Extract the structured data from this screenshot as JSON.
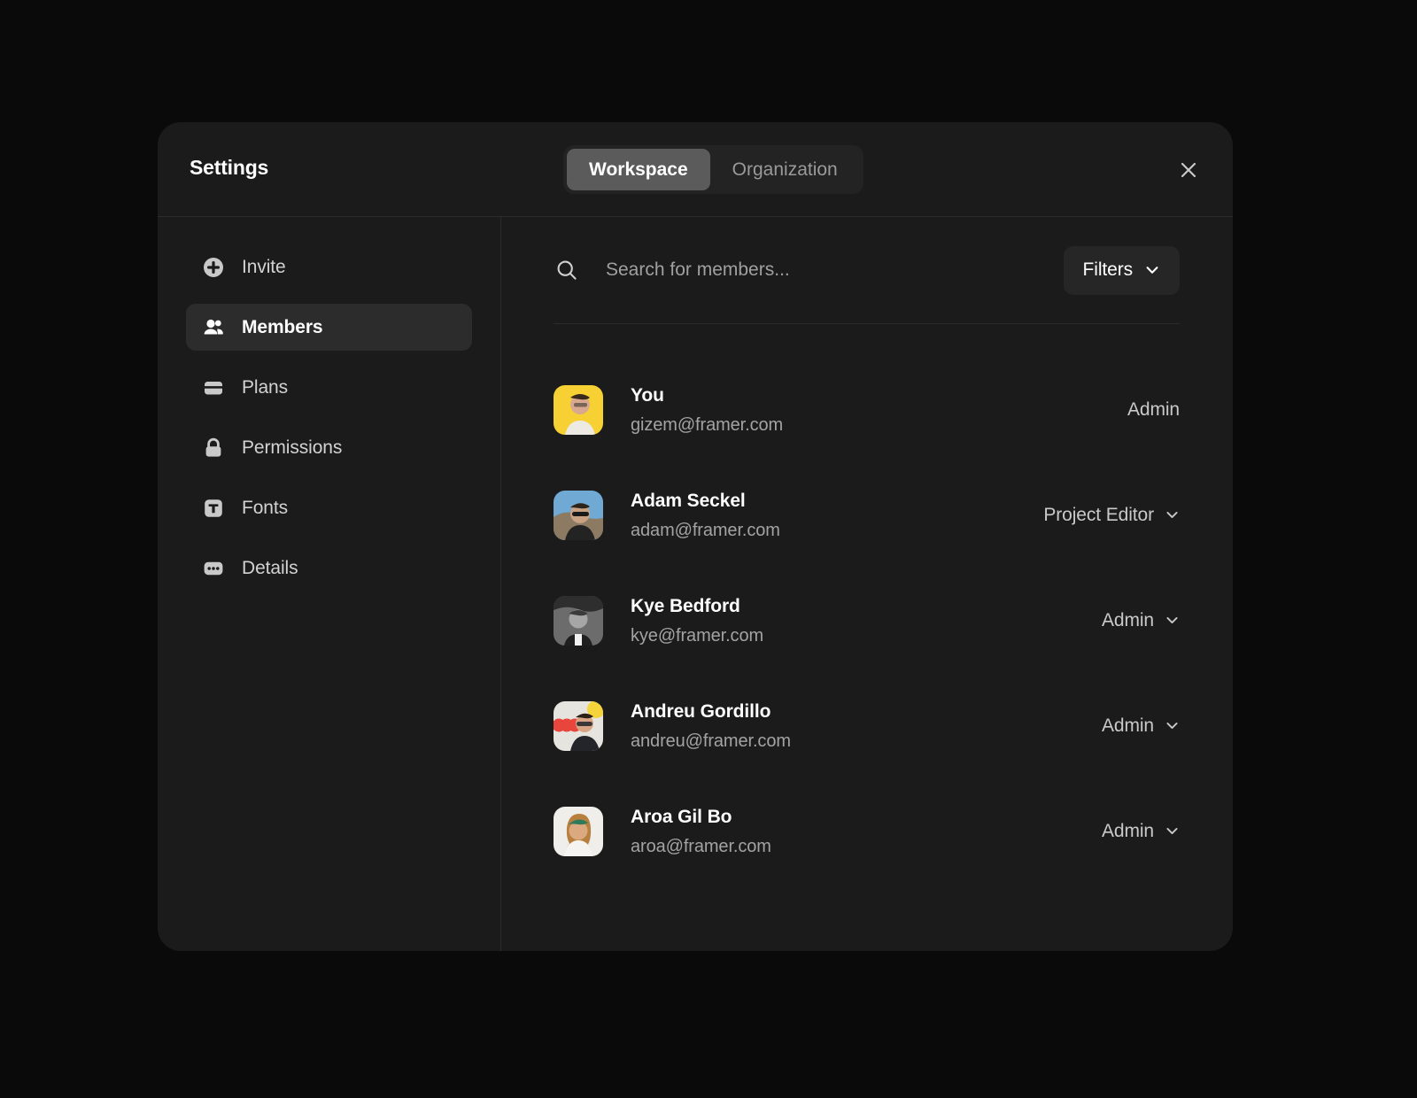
{
  "header": {
    "title": "Settings",
    "tabs": [
      {
        "label": "Workspace",
        "active": true
      },
      {
        "label": "Organization",
        "active": false
      }
    ],
    "close_label": "Close"
  },
  "sidebar": {
    "items": [
      {
        "label": "Invite",
        "icon": "plus-circle-icon",
        "active": false
      },
      {
        "label": "Members",
        "icon": "members-icon",
        "active": true
      },
      {
        "label": "Plans",
        "icon": "card-icon",
        "active": false
      },
      {
        "label": "Permissions",
        "icon": "lock-icon",
        "active": false
      },
      {
        "label": "Fonts",
        "icon": "fonts-icon",
        "active": false
      },
      {
        "label": "Details",
        "icon": "ellipsis-icon",
        "active": false
      }
    ]
  },
  "search": {
    "placeholder": "Search for members...",
    "value": "",
    "icon": "search-icon"
  },
  "filters": {
    "label": "Filters",
    "icon": "chevron-down-icon"
  },
  "members": [
    {
      "name": "You",
      "email": "gizem@framer.com",
      "role": "Admin",
      "role_editable": false,
      "avatar": "avatar-gizem"
    },
    {
      "name": "Adam Seckel",
      "email": "adam@framer.com",
      "role": "Project Editor",
      "role_editable": true,
      "avatar": "avatar-adam"
    },
    {
      "name": "Kye Bedford",
      "email": "kye@framer.com",
      "role": "Admin",
      "role_editable": true,
      "avatar": "avatar-kye"
    },
    {
      "name": "Andreu Gordillo",
      "email": "andreu@framer.com",
      "role": "Admin",
      "role_editable": true,
      "avatar": "avatar-andreu"
    },
    {
      "name": "Aroa Gil Bo",
      "email": "aroa@framer.com",
      "role": "Admin",
      "role_editable": true,
      "avatar": "avatar-aroa"
    }
  ],
  "colors": {
    "page_background": "#0a0a0a",
    "panel_background": "#1b1b1b",
    "active_nav": "#2c2c2c",
    "active_tab": "#5b5b5b",
    "divider": "#2b2b2b",
    "text_primary": "#ffffff",
    "text_secondary": "#a3a3a3"
  }
}
